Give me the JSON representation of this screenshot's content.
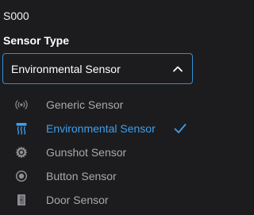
{
  "device_id": "S000",
  "sensor_type_field": {
    "label": "Sensor Type",
    "selected_value": "Environmental Sensor"
  },
  "options": [
    {
      "label": "Generic Sensor",
      "icon": "broadcast-icon",
      "selected": false
    },
    {
      "label": "Environmental Sensor",
      "icon": "environmental-sensor-icon",
      "selected": true
    },
    {
      "label": "Gunshot Sensor",
      "icon": "gunshot-sensor-icon",
      "selected": false
    },
    {
      "label": "Button Sensor",
      "icon": "button-sensor-icon",
      "selected": false
    },
    {
      "label": "Door Sensor",
      "icon": "door-icon",
      "selected": false
    }
  ],
  "colors": {
    "background": "#1c1c1e",
    "accent": "#3d9ff0",
    "muted_text": "#a8a8ae",
    "muted_icon": "#8e8e93"
  }
}
